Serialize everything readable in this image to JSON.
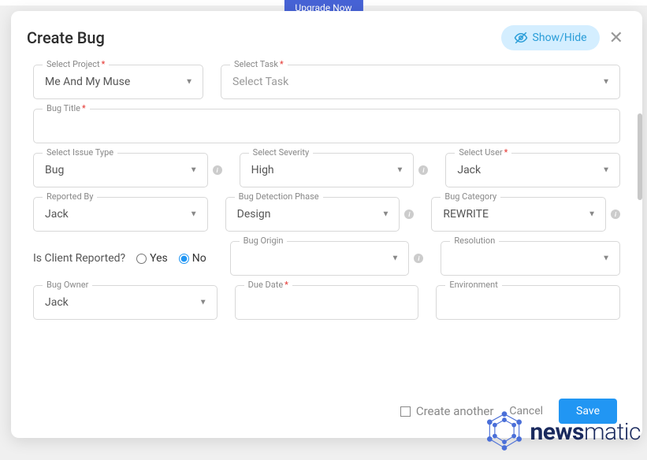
{
  "banner": {
    "upgrade": "Upgrade Now"
  },
  "modal": {
    "title": "Create Bug",
    "showhide": "Show/Hide"
  },
  "fields": {
    "project": {
      "label": "Select Project",
      "value": "Me And My Muse"
    },
    "task": {
      "label": "Select Task",
      "placeholder": "Select Task"
    },
    "bugTitle": {
      "label": "Bug Title"
    },
    "issueType": {
      "label": "Select Issue Type",
      "value": "Bug"
    },
    "severity": {
      "label": "Select Severity",
      "value": "High"
    },
    "user": {
      "label": "Select User",
      "value": "Jack"
    },
    "reportedBy": {
      "label": "Reported By",
      "value": "Jack"
    },
    "detectionPhase": {
      "label": "Bug Detection Phase",
      "value": "Design"
    },
    "category": {
      "label": "Bug Category",
      "value": "REWRITE"
    },
    "clientReported": {
      "label": "Is Client Reported?",
      "yes": "Yes",
      "no": "No"
    },
    "origin": {
      "label": "Bug Origin"
    },
    "resolution": {
      "label": "Resolution"
    },
    "owner": {
      "label": "Bug Owner",
      "value": "Jack"
    },
    "dueDate": {
      "label": "Due Date"
    },
    "environment": {
      "label": "Environment"
    }
  },
  "footer": {
    "createAnother": "Create another",
    "cancel": "Cancel",
    "save": "Save"
  },
  "watermark": {
    "brand1": "news",
    "brand2": "matic"
  }
}
